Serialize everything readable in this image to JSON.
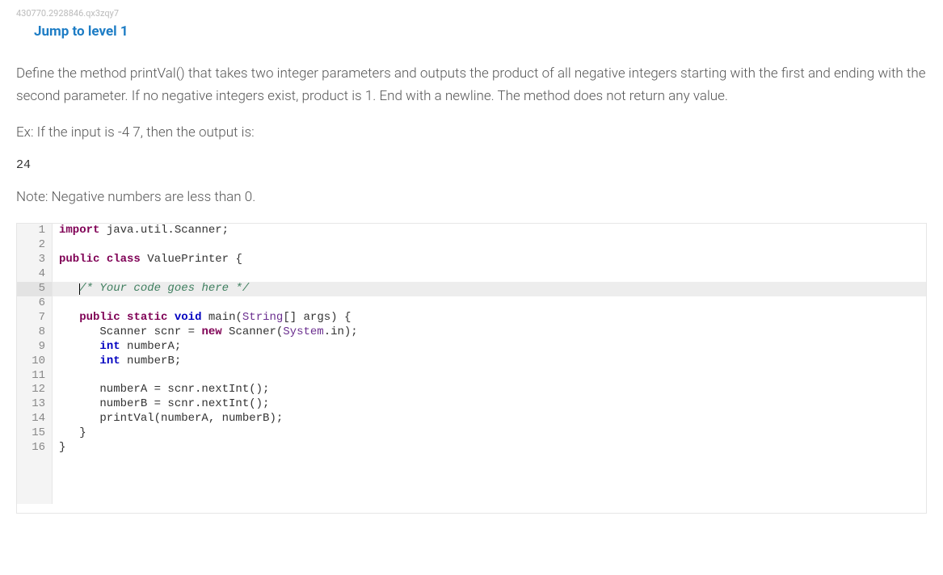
{
  "breadcrumb": "430770.2928846.qx3zqy7",
  "jump_link": "Jump to level 1",
  "problem": {
    "description": "Define the method printVal() that takes two integer parameters and outputs the product of all negative integers starting with the first and ending with the second parameter. If no negative integers exist, product is 1. End with a newline. The method does not return any value.",
    "example_prompt": "Ex: If the input is -4 7, then the output is:",
    "example_output": "24",
    "note": "Note: Negative numbers are less than 0."
  },
  "code": {
    "highlighted_line": 5,
    "lines": [
      {
        "n": 1,
        "tokens": [
          {
            "c": "tok-import",
            "t": "import"
          },
          {
            "t": " java.util.Scanner;"
          }
        ]
      },
      {
        "n": 2,
        "tokens": []
      },
      {
        "n": 3,
        "tokens": [
          {
            "c": "tok-import",
            "t": "public"
          },
          {
            "t": " "
          },
          {
            "c": "tok-import",
            "t": "class"
          },
          {
            "t": " ValuePrinter {"
          }
        ]
      },
      {
        "n": 4,
        "tokens": []
      },
      {
        "n": 5,
        "tokens": [
          {
            "t": "   "
          },
          {
            "cursor": true
          },
          {
            "c": "tok-comment",
            "t": "/* Your code goes here */"
          }
        ]
      },
      {
        "n": 6,
        "tokens": []
      },
      {
        "n": 7,
        "tokens": [
          {
            "t": "   "
          },
          {
            "c": "tok-import",
            "t": "public"
          },
          {
            "t": " "
          },
          {
            "c": "tok-import",
            "t": "static"
          },
          {
            "t": " "
          },
          {
            "c": "tok-keyword",
            "t": "void"
          },
          {
            "t": " main("
          },
          {
            "c": "tok-sys",
            "t": "String"
          },
          {
            "t": "[] args) {"
          }
        ]
      },
      {
        "n": 8,
        "tokens": [
          {
            "t": "      Scanner scnr = "
          },
          {
            "c": "tok-import",
            "t": "new"
          },
          {
            "t": " Scanner("
          },
          {
            "c": "tok-sys",
            "t": "System"
          },
          {
            "t": ".in);"
          }
        ]
      },
      {
        "n": 9,
        "tokens": [
          {
            "t": "      "
          },
          {
            "c": "tok-keyword",
            "t": "int"
          },
          {
            "t": " numberA;"
          }
        ]
      },
      {
        "n": 10,
        "tokens": [
          {
            "t": "      "
          },
          {
            "c": "tok-keyword",
            "t": "int"
          },
          {
            "t": " numberB;"
          }
        ]
      },
      {
        "n": 11,
        "tokens": []
      },
      {
        "n": 12,
        "tokens": [
          {
            "t": "      numberA = scnr.nextInt();"
          }
        ]
      },
      {
        "n": 13,
        "tokens": [
          {
            "t": "      numberB = scnr.nextInt();"
          }
        ]
      },
      {
        "n": 14,
        "tokens": [
          {
            "t": "      printVal(numberA, numberB);"
          }
        ]
      },
      {
        "n": 15,
        "tokens": [
          {
            "t": "   }"
          }
        ]
      },
      {
        "n": 16,
        "tokens": [
          {
            "t": "}"
          }
        ]
      }
    ]
  }
}
